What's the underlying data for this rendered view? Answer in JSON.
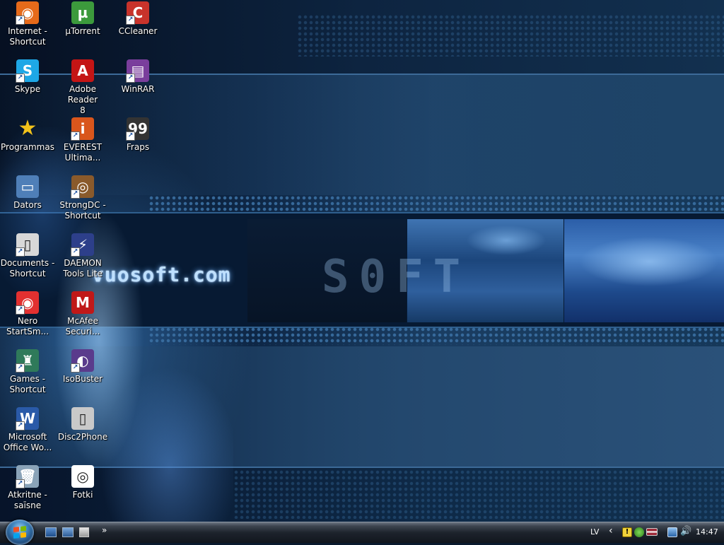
{
  "desktop": {
    "wallpaper_text": "vuosoft.com",
    "icons": [
      {
        "label": "Internet -\nShortcut",
        "icon": "firefox-icon",
        "color": "#e66a1a",
        "glyph": "◉",
        "shortcut": true
      },
      {
        "label": "µTorrent",
        "icon": "utorrent-icon",
        "color": "#3c9a3c",
        "glyph": "µ",
        "shortcut": false
      },
      {
        "label": "CCleaner",
        "icon": "ccleaner-icon",
        "color": "#c8332b",
        "glyph": "C",
        "shortcut": true
      },
      {
        "label": "Skype",
        "icon": "skype-icon",
        "color": "#1ea7e6",
        "glyph": "S",
        "shortcut": true
      },
      {
        "label": "Adobe Reader\n8",
        "icon": "adobe-reader-icon",
        "color": "#c41515",
        "glyph": "A",
        "shortcut": false
      },
      {
        "label": "WinRAR",
        "icon": "winrar-icon",
        "color": "#7a3e9c",
        "glyph": "▤",
        "shortcut": true
      },
      {
        "label": "Programmas",
        "icon": "star-icon",
        "color": "#f2c21a",
        "glyph": "★",
        "shortcut": false
      },
      {
        "label": "EVEREST\nUltima...",
        "icon": "everest-icon",
        "color": "#d9561c",
        "glyph": "i",
        "shortcut": true
      },
      {
        "label": "Fraps",
        "icon": "fraps-icon",
        "color": "#333333",
        "glyph": "99",
        "shortcut": true
      },
      {
        "label": "Dators",
        "icon": "computer-icon",
        "color": "#4f7fb8",
        "glyph": "▭",
        "shortcut": false
      },
      {
        "label": "StrongDC -\nShortcut",
        "icon": "strongdc-icon",
        "color": "#8a5a2b",
        "glyph": "◎",
        "shortcut": true
      },
      {
        "label": "Documents -\nShortcut",
        "icon": "documents-icon",
        "color": "#d8d8d8",
        "glyph": "▯",
        "shortcut": true
      },
      {
        "label": "DAEMON\nTools Lite",
        "icon": "daemon-tools-icon",
        "color": "#2d3f8a",
        "glyph": "⚡",
        "shortcut": true
      },
      {
        "label": "Nero\nStartSm...",
        "icon": "nero-icon",
        "color": "#e23030",
        "glyph": "◉",
        "shortcut": true
      },
      {
        "label": "McAfee\nSecuri...",
        "icon": "mcafee-icon",
        "color": "#c01818",
        "glyph": "M",
        "shortcut": false
      },
      {
        "label": "Games -\nShortcut",
        "icon": "games-icon",
        "color": "#2f7a5a",
        "glyph": "♜",
        "shortcut": true
      },
      {
        "label": "IsoBuster",
        "icon": "isobuster-icon",
        "color": "#5a3b8c",
        "glyph": "◐",
        "shortcut": true
      },
      {
        "label": "Microsoft\nOffice Wo...",
        "icon": "word-icon",
        "color": "#2a5aa8",
        "glyph": "W",
        "shortcut": true
      },
      {
        "label": "Disc2Phone",
        "icon": "disc2phone-icon",
        "color": "#c9c9c9",
        "glyph": "▯",
        "shortcut": false
      },
      {
        "label": "Atkritne -\nsaīsne",
        "icon": "recycle-bin-icon",
        "color": "#8aa3b8",
        "glyph": "🗑",
        "shortcut": true
      },
      {
        "label": "Fotki",
        "icon": "fotki-icon",
        "color": "#ffffff",
        "glyph": "◎",
        "shortcut": false
      }
    ]
  },
  "taskbar": {
    "start_label": "",
    "quicklaunch_more": "»",
    "language": "LV",
    "tray_expand": "‹",
    "tray_warning": "!",
    "volume_glyph": "🔊",
    "clock": "14:47",
    "start_flag_colors": [
      "#f25022",
      "#7fba00",
      "#00a4ef",
      "#ffb900"
    ]
  }
}
